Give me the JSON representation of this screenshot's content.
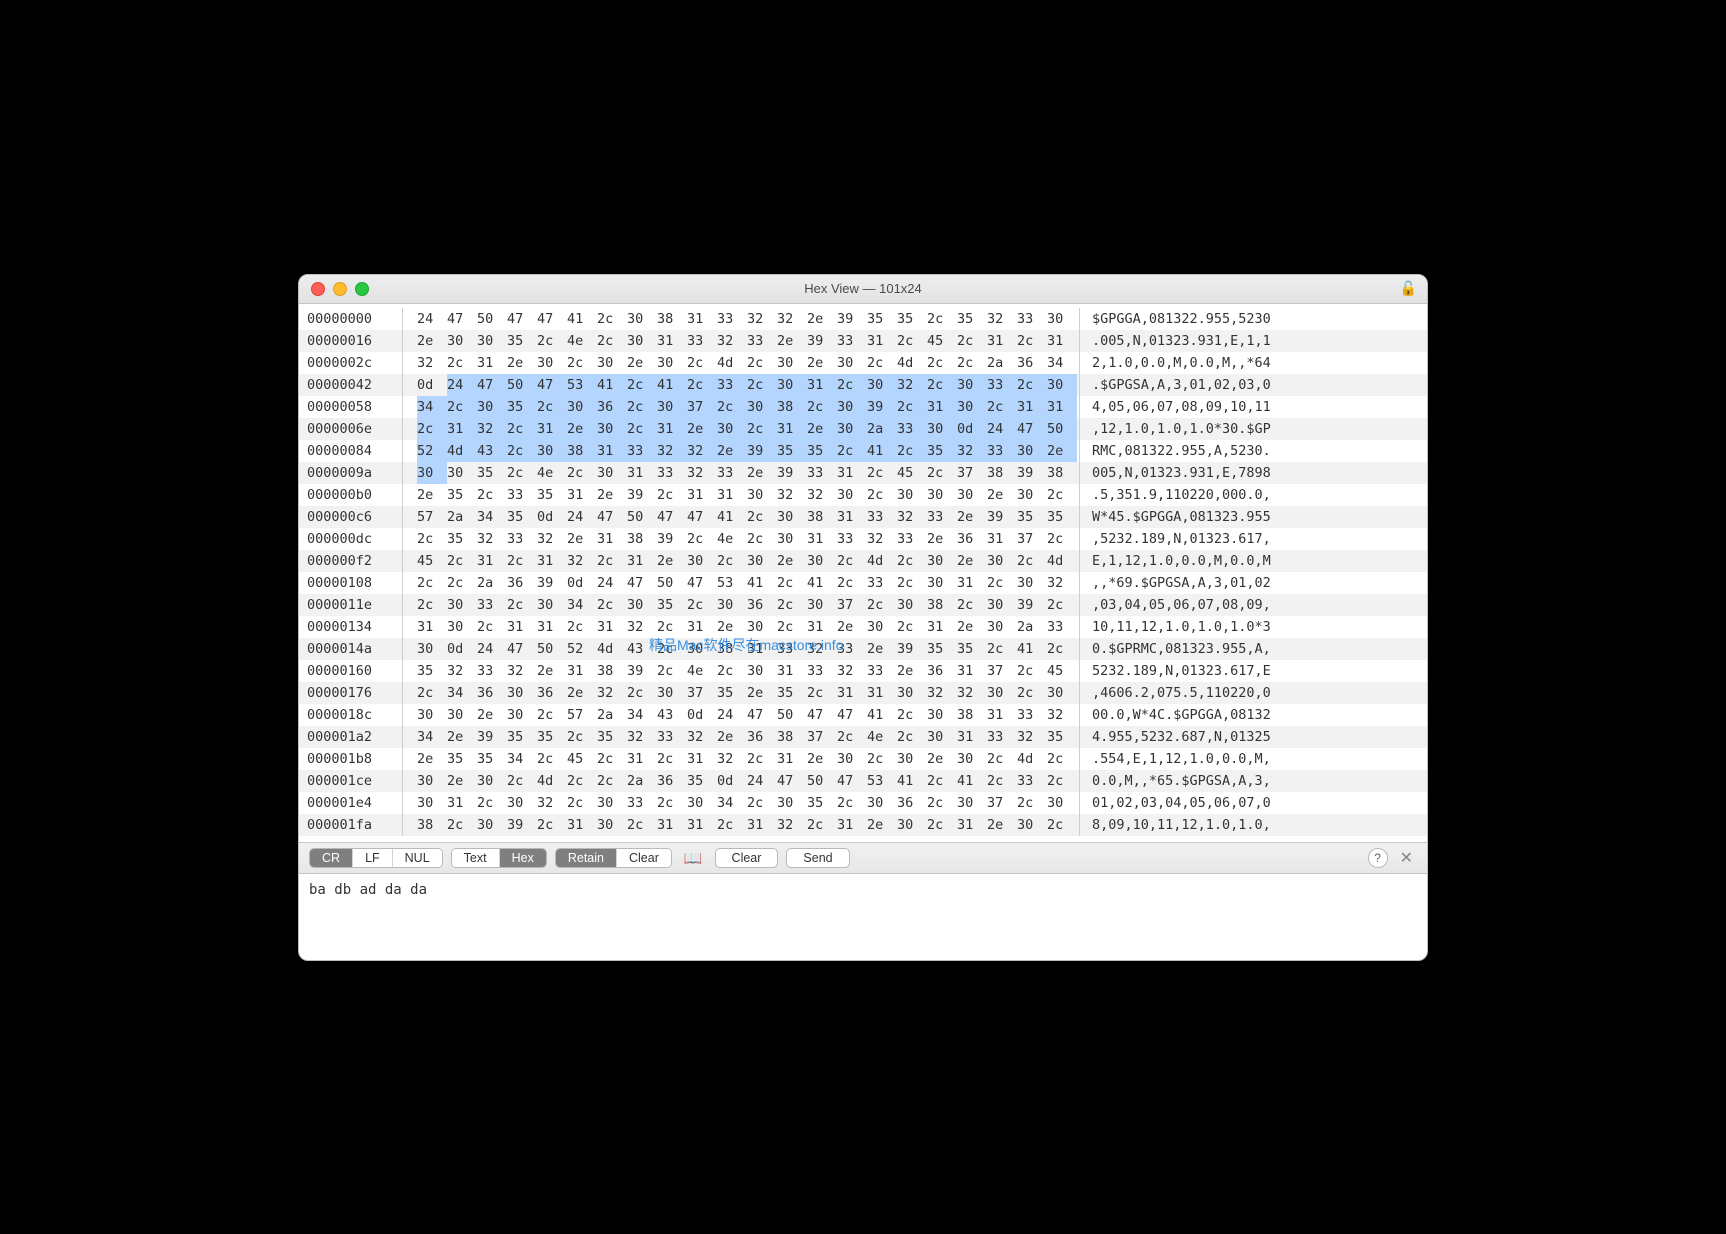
{
  "title": "Hex View — 101x24",
  "watermark": "精品Mac软件尽在macstore.info",
  "input_text": "ba db ad da da",
  "toolbar": {
    "seg1": [
      "CR",
      "LF",
      "NUL"
    ],
    "seg1_active": 0,
    "seg2": [
      "Text",
      "Hex"
    ],
    "seg2_active": 1,
    "seg3": [
      "Retain",
      "Clear"
    ],
    "seg3_active": 0,
    "clear": "Clear",
    "send": "Send"
  },
  "selection": {
    "start": 67,
    "end": 154
  },
  "rows": [
    {
      "offset": "00000000",
      "hex": [
        "24",
        "47",
        "50",
        "47",
        "47",
        "41",
        "2c",
        "30",
        "38",
        "31",
        "33",
        "32",
        "32",
        "2e",
        "39",
        "35",
        "35",
        "2c",
        "35",
        "32",
        "33",
        "30"
      ],
      "ascii": "$GPGGA,081322.955,5230"
    },
    {
      "offset": "00000016",
      "hex": [
        "2e",
        "30",
        "30",
        "35",
        "2c",
        "4e",
        "2c",
        "30",
        "31",
        "33",
        "32",
        "33",
        "2e",
        "39",
        "33",
        "31",
        "2c",
        "45",
        "2c",
        "31",
        "2c",
        "31"
      ],
      "ascii": ".005,N,01323.931,E,1,1"
    },
    {
      "offset": "0000002c",
      "hex": [
        "32",
        "2c",
        "31",
        "2e",
        "30",
        "2c",
        "30",
        "2e",
        "30",
        "2c",
        "4d",
        "2c",
        "30",
        "2e",
        "30",
        "2c",
        "4d",
        "2c",
        "2c",
        "2a",
        "36",
        "34"
      ],
      "ascii": "2,1.0,0.0,M,0.0,M,,*64"
    },
    {
      "offset": "00000042",
      "hex": [
        "0d",
        "24",
        "47",
        "50",
        "47",
        "53",
        "41",
        "2c",
        "41",
        "2c",
        "33",
        "2c",
        "30",
        "31",
        "2c",
        "30",
        "32",
        "2c",
        "30",
        "33",
        "2c",
        "30"
      ],
      "ascii": ".$GPGSA,A,3,01,02,03,0"
    },
    {
      "offset": "00000058",
      "hex": [
        "34",
        "2c",
        "30",
        "35",
        "2c",
        "30",
        "36",
        "2c",
        "30",
        "37",
        "2c",
        "30",
        "38",
        "2c",
        "30",
        "39",
        "2c",
        "31",
        "30",
        "2c",
        "31",
        "31"
      ],
      "ascii": "4,05,06,07,08,09,10,11"
    },
    {
      "offset": "0000006e",
      "hex": [
        "2c",
        "31",
        "32",
        "2c",
        "31",
        "2e",
        "30",
        "2c",
        "31",
        "2e",
        "30",
        "2c",
        "31",
        "2e",
        "30",
        "2a",
        "33",
        "30",
        "0d",
        "24",
        "47",
        "50"
      ],
      "ascii": ",12,1.0,1.0,1.0*30.$GP"
    },
    {
      "offset": "00000084",
      "hex": [
        "52",
        "4d",
        "43",
        "2c",
        "30",
        "38",
        "31",
        "33",
        "32",
        "32",
        "2e",
        "39",
        "35",
        "35",
        "2c",
        "41",
        "2c",
        "35",
        "32",
        "33",
        "30",
        "2e"
      ],
      "ascii": "RMC,081322.955,A,5230."
    },
    {
      "offset": "0000009a",
      "hex": [
        "30",
        "30",
        "35",
        "2c",
        "4e",
        "2c",
        "30",
        "31",
        "33",
        "32",
        "33",
        "2e",
        "39",
        "33",
        "31",
        "2c",
        "45",
        "2c",
        "37",
        "38",
        "39",
        "38"
      ],
      "ascii": "005,N,01323.931,E,7898"
    },
    {
      "offset": "000000b0",
      "hex": [
        "2e",
        "35",
        "2c",
        "33",
        "35",
        "31",
        "2e",
        "39",
        "2c",
        "31",
        "31",
        "30",
        "32",
        "32",
        "30",
        "2c",
        "30",
        "30",
        "30",
        "2e",
        "30",
        "2c"
      ],
      "ascii": ".5,351.9,110220,000.0,"
    },
    {
      "offset": "000000c6",
      "hex": [
        "57",
        "2a",
        "34",
        "35",
        "0d",
        "24",
        "47",
        "50",
        "47",
        "47",
        "41",
        "2c",
        "30",
        "38",
        "31",
        "33",
        "32",
        "33",
        "2e",
        "39",
        "35",
        "35"
      ],
      "ascii": "W*45.$GPGGA,081323.955"
    },
    {
      "offset": "000000dc",
      "hex": [
        "2c",
        "35",
        "32",
        "33",
        "32",
        "2e",
        "31",
        "38",
        "39",
        "2c",
        "4e",
        "2c",
        "30",
        "31",
        "33",
        "32",
        "33",
        "2e",
        "36",
        "31",
        "37",
        "2c"
      ],
      "ascii": ",5232.189,N,01323.617,"
    },
    {
      "offset": "000000f2",
      "hex": [
        "45",
        "2c",
        "31",
        "2c",
        "31",
        "32",
        "2c",
        "31",
        "2e",
        "30",
        "2c",
        "30",
        "2e",
        "30",
        "2c",
        "4d",
        "2c",
        "30",
        "2e",
        "30",
        "2c",
        "4d"
      ],
      "ascii": "E,1,12,1.0,0.0,M,0.0,M"
    },
    {
      "offset": "00000108",
      "hex": [
        "2c",
        "2c",
        "2a",
        "36",
        "39",
        "0d",
        "24",
        "47",
        "50",
        "47",
        "53",
        "41",
        "2c",
        "41",
        "2c",
        "33",
        "2c",
        "30",
        "31",
        "2c",
        "30",
        "32"
      ],
      "ascii": ",,*69.$GPGSA,A,3,01,02"
    },
    {
      "offset": "0000011e",
      "hex": [
        "2c",
        "30",
        "33",
        "2c",
        "30",
        "34",
        "2c",
        "30",
        "35",
        "2c",
        "30",
        "36",
        "2c",
        "30",
        "37",
        "2c",
        "30",
        "38",
        "2c",
        "30",
        "39",
        "2c"
      ],
      "ascii": ",03,04,05,06,07,08,09,"
    },
    {
      "offset": "00000134",
      "hex": [
        "31",
        "30",
        "2c",
        "31",
        "31",
        "2c",
        "31",
        "32",
        "2c",
        "31",
        "2e",
        "30",
        "2c",
        "31",
        "2e",
        "30",
        "2c",
        "31",
        "2e",
        "30",
        "2a",
        "33"
      ],
      "ascii": "10,11,12,1.0,1.0,1.0*3"
    },
    {
      "offset": "0000014a",
      "hex": [
        "30",
        "0d",
        "24",
        "47",
        "50",
        "52",
        "4d",
        "43",
        "2c",
        "30",
        "38",
        "31",
        "33",
        "32",
        "33",
        "2e",
        "39",
        "35",
        "35",
        "2c",
        "41",
        "2c"
      ],
      "ascii": "0.$GPRMC,081323.955,A,"
    },
    {
      "offset": "00000160",
      "hex": [
        "35",
        "32",
        "33",
        "32",
        "2e",
        "31",
        "38",
        "39",
        "2c",
        "4e",
        "2c",
        "30",
        "31",
        "33",
        "32",
        "33",
        "2e",
        "36",
        "31",
        "37",
        "2c",
        "45"
      ],
      "ascii": "5232.189,N,01323.617,E"
    },
    {
      "offset": "00000176",
      "hex": [
        "2c",
        "34",
        "36",
        "30",
        "36",
        "2e",
        "32",
        "2c",
        "30",
        "37",
        "35",
        "2e",
        "35",
        "2c",
        "31",
        "31",
        "30",
        "32",
        "32",
        "30",
        "2c",
        "30"
      ],
      "ascii": ",4606.2,075.5,110220,0"
    },
    {
      "offset": "0000018c",
      "hex": [
        "30",
        "30",
        "2e",
        "30",
        "2c",
        "57",
        "2a",
        "34",
        "43",
        "0d",
        "24",
        "47",
        "50",
        "47",
        "47",
        "41",
        "2c",
        "30",
        "38",
        "31",
        "33",
        "32"
      ],
      "ascii": "00.0,W*4C.$GPGGA,08132"
    },
    {
      "offset": "000001a2",
      "hex": [
        "34",
        "2e",
        "39",
        "35",
        "35",
        "2c",
        "35",
        "32",
        "33",
        "32",
        "2e",
        "36",
        "38",
        "37",
        "2c",
        "4e",
        "2c",
        "30",
        "31",
        "33",
        "32",
        "35"
      ],
      "ascii": "4.955,5232.687,N,01325"
    },
    {
      "offset": "000001b8",
      "hex": [
        "2e",
        "35",
        "35",
        "34",
        "2c",
        "45",
        "2c",
        "31",
        "2c",
        "31",
        "32",
        "2c",
        "31",
        "2e",
        "30",
        "2c",
        "30",
        "2e",
        "30",
        "2c",
        "4d",
        "2c"
      ],
      "ascii": ".554,E,1,12,1.0,0.0,M,"
    },
    {
      "offset": "000001ce",
      "hex": [
        "30",
        "2e",
        "30",
        "2c",
        "4d",
        "2c",
        "2c",
        "2a",
        "36",
        "35",
        "0d",
        "24",
        "47",
        "50",
        "47",
        "53",
        "41",
        "2c",
        "41",
        "2c",
        "33",
        "2c"
      ],
      "ascii": "0.0,M,,*65.$GPGSA,A,3,"
    },
    {
      "offset": "000001e4",
      "hex": [
        "30",
        "31",
        "2c",
        "30",
        "32",
        "2c",
        "30",
        "33",
        "2c",
        "30",
        "34",
        "2c",
        "30",
        "35",
        "2c",
        "30",
        "36",
        "2c",
        "30",
        "37",
        "2c",
        "30"
      ],
      "ascii": "01,02,03,04,05,06,07,0"
    },
    {
      "offset": "000001fa",
      "hex": [
        "38",
        "2c",
        "30",
        "39",
        "2c",
        "31",
        "30",
        "2c",
        "31",
        "31",
        "2c",
        "31",
        "32",
        "2c",
        "31",
        "2e",
        "30",
        "2c",
        "31",
        "2e",
        "30",
        "2c"
      ],
      "ascii": "8,09,10,11,12,1.0,1.0,"
    }
  ]
}
